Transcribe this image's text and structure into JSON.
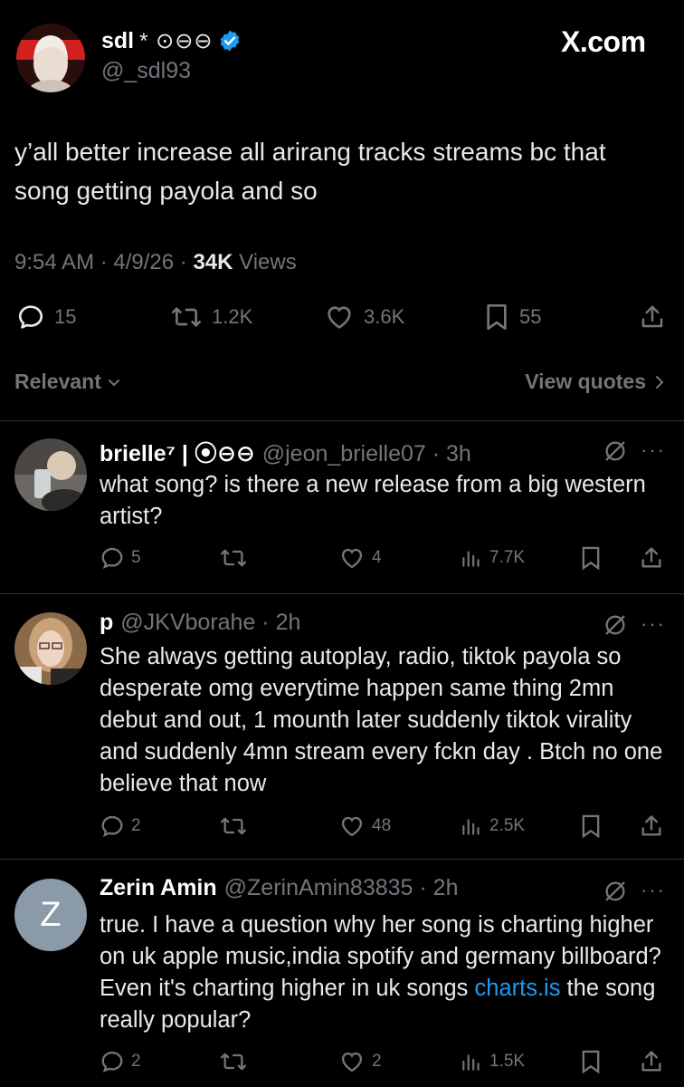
{
  "main": {
    "name": "sdl",
    "name_extra": "* ⊙⊖⊖",
    "handle": "@_sdl93",
    "watermark": "X.com",
    "text": "y’all better increase all arirang tracks streams bc that song getting payola and so",
    "time": "9:54 AM · 4/9/26 · ",
    "views_count": "34K",
    "views_label": " Views",
    "actions": {
      "replies": "15",
      "reposts": "1.2K",
      "likes": "3.6K",
      "bookmarks": "55"
    },
    "colors": {
      "verified": "#1d9bf0"
    }
  },
  "filter": {
    "sort": "Relevant",
    "quotes": "View quotes"
  },
  "replies": [
    {
      "name": "brielle⁷ | ⦿⊖⊖",
      "handle_time": "@jeon_brielle07 · 3h",
      "text": "what song? is there a new release from a big western artist?",
      "replies": "5",
      "reposts": "",
      "likes": "4",
      "views": "7.7K"
    },
    {
      "name": "p",
      "handle_time": "@JKVborahe · 2h",
      "text": "She always getting autoplay, radio, tiktok payola so desperate omg everytime happen same thing 2mn debut and out, 1 mounth later suddenly tiktok virality and suddenly 4mn stream every fckn day . Btch no one believe that now",
      "replies": "2",
      "reposts": "",
      "likes": "48",
      "views": "2.5K"
    },
    {
      "name": "Zerin Amin",
      "handle_time": "@ZerinAmin83835 · 2h",
      "avatar_letter": "Z",
      "text_before_link": "true. I have a question why her song is charting higher on uk apple music,india spotify and germany billboard? Even it's charting higher in uk songs ",
      "link_text": "charts.is",
      "text_after_link": " the song really popular?",
      "replies": "2",
      "reposts": "",
      "likes": "2",
      "views": "1.5K"
    }
  ]
}
